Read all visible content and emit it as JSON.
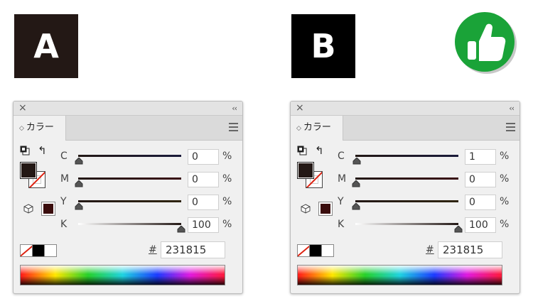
{
  "panels": [
    {
      "badge": "A",
      "badge_color": "#231815",
      "tab_label": "カラー",
      "swatch_color": "#231815",
      "channels": [
        {
          "label": "C",
          "value": "0"
        },
        {
          "label": "M",
          "value": "0"
        },
        {
          "label": "Y",
          "value": "0"
        },
        {
          "label": "K",
          "value": "100"
        }
      ],
      "percent": "%",
      "hash": "#",
      "hex": "231815"
    },
    {
      "badge": "B",
      "badge_color": "#000000",
      "tab_label": "カラー",
      "swatch_color": "#231815",
      "channels": [
        {
          "label": "C",
          "value": "1"
        },
        {
          "label": "M",
          "value": "0"
        },
        {
          "label": "Y",
          "value": "0"
        },
        {
          "label": "K",
          "value": "100"
        }
      ],
      "percent": "%",
      "hash": "#",
      "hex": "231815"
    }
  ],
  "thumbs_up": {
    "icon": "thumbs-up-icon",
    "color": "#1aa338"
  }
}
